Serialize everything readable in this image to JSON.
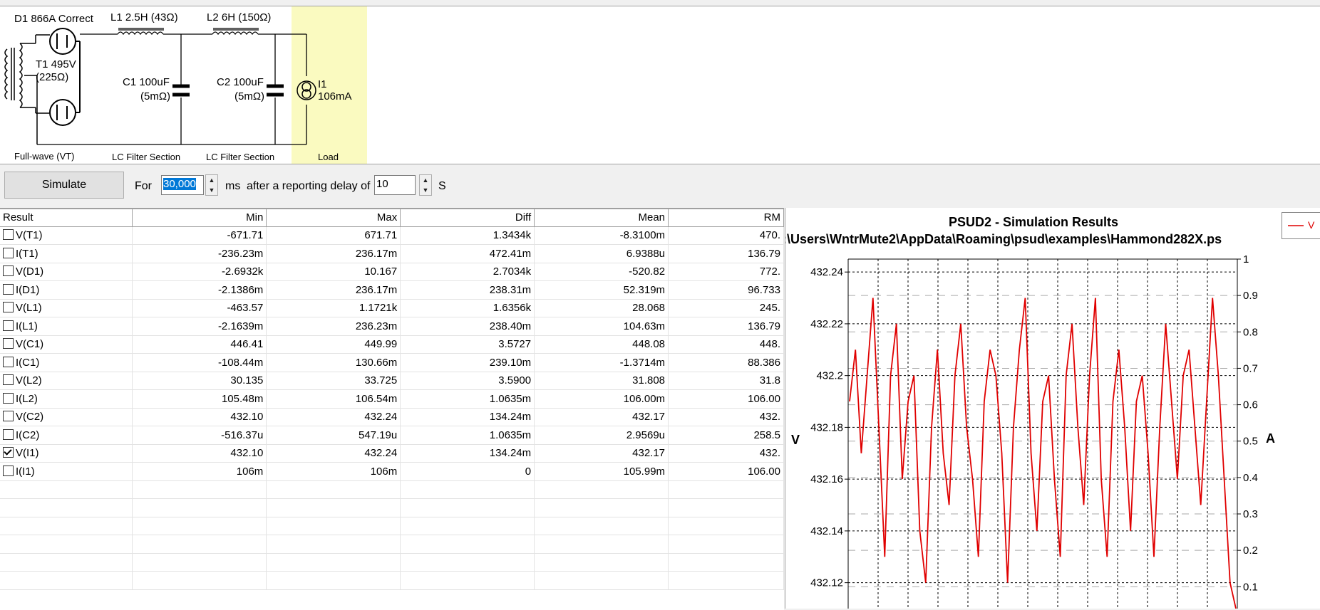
{
  "schematic": {
    "d1_label": "D1 866A Correct",
    "l1_label": "L1 2.5H (43Ω)",
    "l2_label": "L2 6H (150Ω)",
    "t1_label": "T1 495V",
    "t1_res": "(225Ω)",
    "c1_label": "C1 100uF",
    "c1_res": "(5mΩ)",
    "c2_label": "C2 100uF",
    "c2_res": "(5mΩ)",
    "i1_label": "I1",
    "i1_value": "106mA",
    "sections": [
      "Full-wave (VT)",
      "LC Filter Section",
      "LC Filter Section",
      "Load"
    ]
  },
  "controls": {
    "simulate_label": "Simulate",
    "for_label": "For",
    "duration_value": "30,000",
    "ms_label": "ms",
    "delay_label": "after a reporting delay of",
    "delay_value": "10",
    "s_label": "S"
  },
  "table": {
    "headers": [
      "Result",
      "Min",
      "Max",
      "Diff",
      "Mean",
      "RM"
    ],
    "rows": [
      {
        "name": "V(T1)",
        "checked": false,
        "min": "-671.71",
        "max": "671.71",
        "diff": "1.3434k",
        "mean": "-8.3100m",
        "rms": "470."
      },
      {
        "name": "I(T1)",
        "checked": false,
        "min": "-236.23m",
        "max": "236.17m",
        "diff": "472.41m",
        "mean": "6.9388u",
        "rms": "136.79"
      },
      {
        "name": "V(D1)",
        "checked": false,
        "min": "-2.6932k",
        "max": "10.167",
        "diff": "2.7034k",
        "mean": "-520.82",
        "rms": "772."
      },
      {
        "name": "I(D1)",
        "checked": false,
        "min": "-2.1386m",
        "max": "236.17m",
        "diff": "238.31m",
        "mean": "52.319m",
        "rms": "96.733"
      },
      {
        "name": "V(L1)",
        "checked": false,
        "min": "-463.57",
        "max": "1.1721k",
        "diff": "1.6356k",
        "mean": "28.068",
        "rms": "245."
      },
      {
        "name": "I(L1)",
        "checked": false,
        "min": "-2.1639m",
        "max": "236.23m",
        "diff": "238.40m",
        "mean": "104.63m",
        "rms": "136.79"
      },
      {
        "name": "V(C1)",
        "checked": false,
        "min": "446.41",
        "max": "449.99",
        "diff": "3.5727",
        "mean": "448.08",
        "rms": "448."
      },
      {
        "name": "I(C1)",
        "checked": false,
        "min": "-108.44m",
        "max": "130.66m",
        "diff": "239.10m",
        "mean": "-1.3714m",
        "rms": "88.386"
      },
      {
        "name": "V(L2)",
        "checked": false,
        "min": "30.135",
        "max": "33.725",
        "diff": "3.5900",
        "mean": "31.808",
        "rms": "31.8"
      },
      {
        "name": "I(L2)",
        "checked": false,
        "min": "105.48m",
        "max": "106.54m",
        "diff": "1.0635m",
        "mean": "106.00m",
        "rms": "106.00"
      },
      {
        "name": "V(C2)",
        "checked": false,
        "min": "432.10",
        "max": "432.24",
        "diff": "134.24m",
        "mean": "432.17",
        "rms": "432."
      },
      {
        "name": "I(C2)",
        "checked": false,
        "min": "-516.37u",
        "max": "547.19u",
        "diff": "1.0635m",
        "mean": "2.9569u",
        "rms": "258.5"
      },
      {
        "name": "V(I1)",
        "checked": true,
        "min": "432.10",
        "max": "432.24",
        "diff": "134.24m",
        "mean": "432.17",
        "rms": "432."
      },
      {
        "name": "I(I1)",
        "checked": false,
        "min": "106m",
        "max": "106m",
        "diff": "0",
        "mean": "105.99m",
        "rms": "106.00"
      }
    ]
  },
  "chart": {
    "title": "PSUD2 - Simulation Results",
    "path": ":\\Users\\WntrMute2\\AppData\\Roaming\\psud\\examples\\Hammond282X.ps",
    "left_axis_label": "V",
    "right_axis_label": "A",
    "legend_text": "V",
    "line_color": "#e00000"
  },
  "chart_data": {
    "type": "line",
    "title": "PSUD2 - Simulation Results",
    "ylabel": "V",
    "y2label": "A",
    "ylim": [
      432.11,
      432.245
    ],
    "y2lim": [
      0.04,
      1.0
    ],
    "left_ticks": [
      "432.24",
      "432.22",
      "432.2",
      "432.18",
      "432.16",
      "432.14",
      "432.12"
    ],
    "right_ticks": [
      "1",
      "0.9",
      "0.8",
      "0.7",
      "0.6",
      "0.5",
      "0.4",
      "0.3",
      "0.2",
      "0.1"
    ],
    "grid": true,
    "series": [
      {
        "name": "V",
        "color": "#e00000",
        "values": [
          432.19,
          432.21,
          432.17,
          432.2,
          432.23,
          432.18,
          432.13,
          432.2,
          432.22,
          432.16,
          432.19,
          432.2,
          432.14,
          432.12,
          432.18,
          432.21,
          432.17,
          432.15,
          432.2,
          432.22,
          432.18,
          432.16,
          432.13,
          432.19,
          432.21,
          432.2,
          432.17,
          432.12,
          432.18,
          432.21,
          432.23,
          432.17,
          432.14,
          432.19,
          432.2,
          432.16,
          432.13,
          432.2,
          432.22,
          432.18,
          432.15,
          432.2,
          432.23,
          432.16,
          432.13,
          432.19,
          432.21,
          432.18,
          432.14,
          432.19,
          432.2,
          432.17,
          432.13,
          432.18,
          432.22,
          432.19,
          432.16,
          432.2,
          432.21,
          432.18,
          432.15,
          432.19,
          432.23,
          432.2,
          432.16,
          432.12,
          432.11
        ]
      }
    ]
  }
}
